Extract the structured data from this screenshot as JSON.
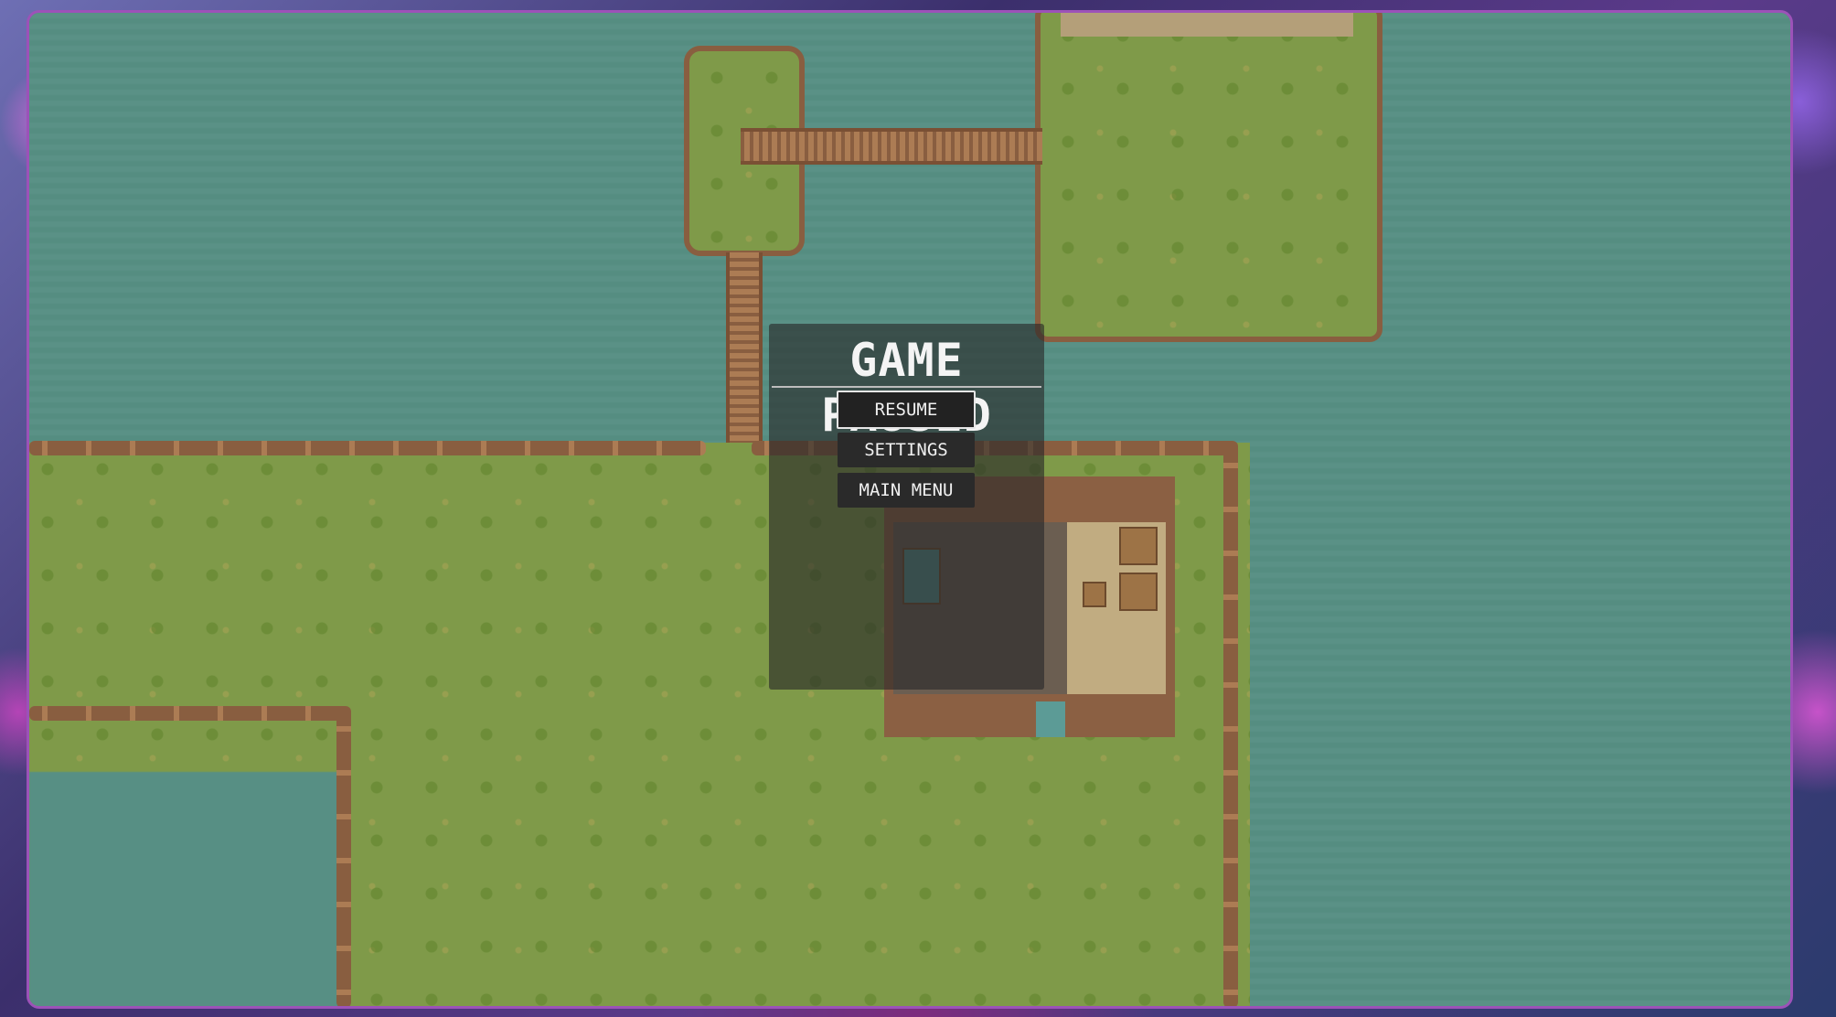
{
  "pause_menu": {
    "title": "GAME PAUSED",
    "buttons": [
      {
        "label": "RESUME",
        "selected": true
      },
      {
        "label": "SETTINGS",
        "selected": false
      },
      {
        "label": "MAIN MENU",
        "selected": false
      }
    ]
  },
  "colors": {
    "water": "#548f86",
    "grass": "#7f9b46",
    "fence": "#8a5a3c",
    "frame_border": "#9c52b8",
    "panel_bg": "rgba(40,40,40,0.62)",
    "text": "#f4f4f4"
  }
}
